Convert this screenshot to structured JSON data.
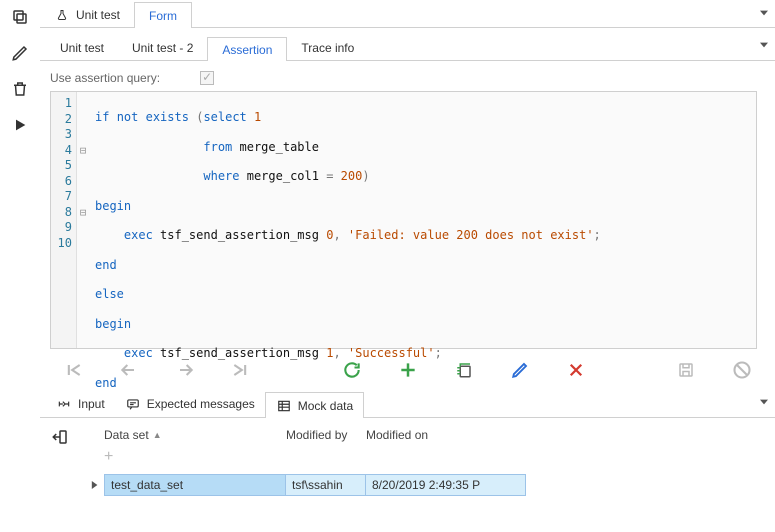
{
  "top_tabs": {
    "unit_test": "Unit test",
    "form": "Form"
  },
  "sub_tabs": {
    "unit_test": "Unit test",
    "unit_test_2": "Unit test - 2",
    "assertion": "Assertion",
    "trace_info": "Trace info"
  },
  "assertion": {
    "label": "Use assertion query:",
    "code_lines": [
      "if not exists (select 1",
      "               from merge_table",
      "               where merge_col1 = 200)",
      "begin",
      "    exec tsf_send_assertion_msg 0, 'Failed: value 200 does not exist';",
      "end",
      "else",
      "begin",
      "    exec tsf_send_assertion_msg 1, 'Successful';",
      "end"
    ]
  },
  "bottom_tabs": {
    "input": "Input",
    "expected": "Expected messages",
    "mock": "Mock data"
  },
  "grid": {
    "headers": {
      "data_set": "Data set",
      "modified_by": "Modified by",
      "modified_on": "Modified on"
    },
    "add_label": "+",
    "rows": [
      {
        "data_set": "test_data_set",
        "modified_by": "tsf\\ssahin",
        "modified_on": "8/20/2019 2:49:35 P"
      }
    ]
  }
}
